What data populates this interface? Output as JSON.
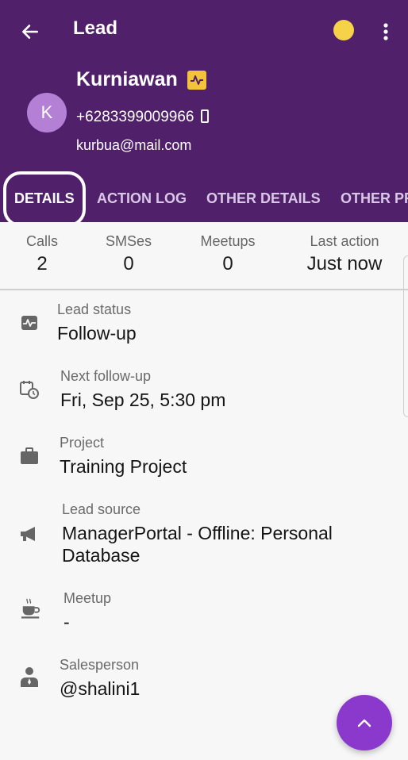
{
  "topbar": {
    "title": "Lead",
    "back_icon": "arrow-left-icon",
    "more_icon": "more-vertical-icon",
    "status_dot_color": "#f5d247"
  },
  "lead": {
    "avatar_initial": "K",
    "name": "Kurniawan",
    "phone": "+6283399009966",
    "email": "kurbua@mail.com"
  },
  "tabs": [
    {
      "label": "DETAILS",
      "active": true
    },
    {
      "label": "ACTION LOG",
      "active": false
    },
    {
      "label": "OTHER DETAILS",
      "active": false
    },
    {
      "label": "OTHER PR",
      "active": false
    }
  ],
  "stats": [
    {
      "label": "Calls",
      "value": "2"
    },
    {
      "label": "SMSes",
      "value": "0"
    },
    {
      "label": "Meetups",
      "value": "0"
    },
    {
      "label": "Last action",
      "value": "Just now"
    }
  ],
  "details": {
    "lead_status": {
      "label": "Lead status",
      "value": "Follow-up",
      "icon": "activity-icon"
    },
    "next_follow_up": {
      "label": "Next follow-up",
      "value": "Fri, Sep 25, 5:30 pm",
      "icon": "calendar-clock-icon"
    },
    "project": {
      "label": "Project",
      "value": "Training Project",
      "icon": "briefcase-icon"
    },
    "lead_source": {
      "label": "Lead source",
      "value": "ManagerPortal - Offline: Personal Database",
      "icon": "megaphone-icon"
    },
    "meetup": {
      "label": "Meetup",
      "value": "-",
      "icon": "coffee-cup-icon"
    },
    "salesperson": {
      "label": "Salesperson",
      "value": "@shalini1",
      "icon": "person-icon"
    }
  },
  "colors": {
    "header": "#51206b",
    "accent": "#8b39cc",
    "badge": "#f3c43a"
  }
}
